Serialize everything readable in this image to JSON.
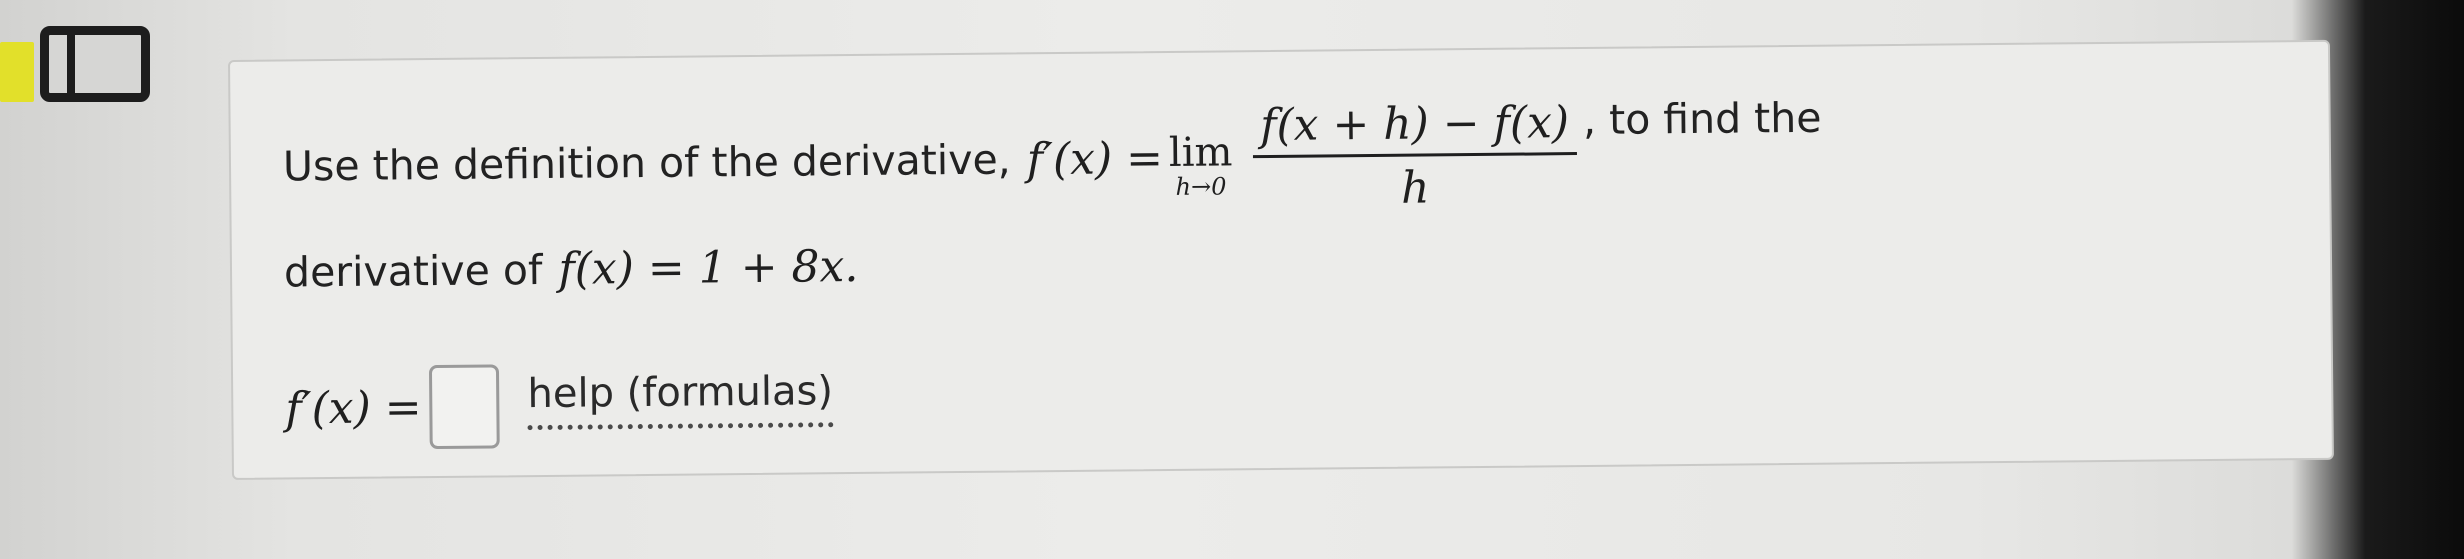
{
  "question": {
    "intro_text": "Use the definition of the derivative,",
    "definition_lhs": "f′(x) =",
    "lim_word": "lim",
    "lim_subscript": "h→0",
    "fraction_numerator": "f(x + h) − f(x)",
    "fraction_denominator": "h",
    "tail_text": ", to find the",
    "line2_text": "derivative of",
    "function_expr": "f(x) = 1 + 8x."
  },
  "answer": {
    "label": "f′(x) =",
    "input_value": "",
    "help_link": "help (formulas)"
  },
  "colors": {
    "accent_yellow": "#e2e02a",
    "text": "#222222",
    "box_border": "#9a9a9a"
  }
}
